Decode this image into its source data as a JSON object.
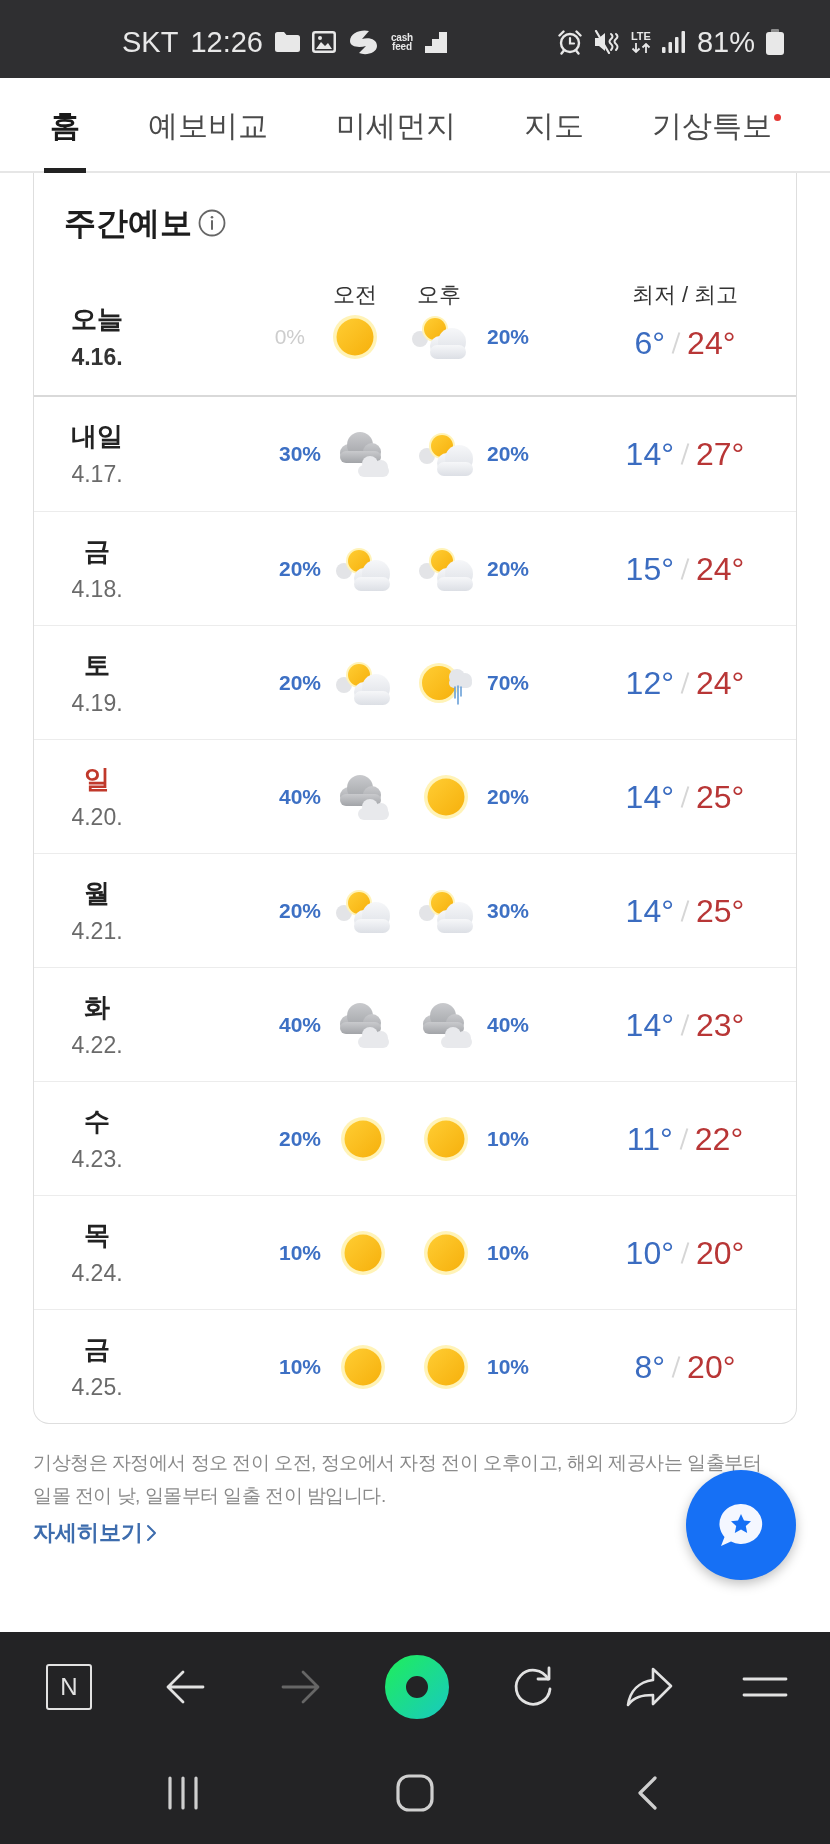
{
  "status_bar": {
    "carrier": "SKT",
    "time": "12:26",
    "app_label": "cash feed",
    "network": "LTE",
    "battery": "81%"
  },
  "tabs": [
    {
      "label": "홈",
      "selected": true,
      "new": false
    },
    {
      "label": "예보비교",
      "selected": false,
      "new": false
    },
    {
      "label": "미세먼지",
      "selected": false,
      "new": false
    },
    {
      "label": "지도",
      "selected": false,
      "new": false
    },
    {
      "label": "기상특보",
      "selected": false,
      "new": true
    }
  ],
  "forecast": {
    "title": "주간예보",
    "am_label": "오전",
    "pm_label": "오후",
    "temp_label": "최저 / 최고",
    "today": {
      "day": "오늘",
      "date": "4.16.",
      "am": {
        "kind": "sunny",
        "pop": "0%",
        "muted": true
      },
      "pm": {
        "kind": "partly_cloudy",
        "pop": "20%",
        "muted": false
      },
      "low": "6°",
      "high": "24°"
    },
    "days": [
      {
        "day": "내일",
        "date": "4.17.",
        "holiday": false,
        "am": {
          "kind": "cloudy",
          "pop": "30%",
          "muted": false
        },
        "pm": {
          "kind": "partly_cloudy",
          "pop": "20%",
          "muted": false
        },
        "low": "14°",
        "high": "27°"
      },
      {
        "day": "금",
        "date": "4.18.",
        "holiday": false,
        "am": {
          "kind": "partly_cloudy",
          "pop": "20%",
          "muted": false
        },
        "pm": {
          "kind": "partly_cloudy",
          "pop": "20%",
          "muted": false
        },
        "low": "15°",
        "high": "24°"
      },
      {
        "day": "토",
        "date": "4.19.",
        "holiday": false,
        "am": {
          "kind": "partly_cloudy",
          "pop": "20%",
          "muted": false
        },
        "pm": {
          "kind": "sun_rain",
          "pop": "70%",
          "muted": false
        },
        "low": "12°",
        "high": "24°"
      },
      {
        "day": "일",
        "date": "4.20.",
        "holiday": true,
        "am": {
          "kind": "cloudy",
          "pop": "40%",
          "muted": false
        },
        "pm": {
          "kind": "sunny",
          "pop": "20%",
          "muted": false
        },
        "low": "14°",
        "high": "25°"
      },
      {
        "day": "월",
        "date": "4.21.",
        "holiday": false,
        "am": {
          "kind": "partly_cloudy",
          "pop": "20%",
          "muted": false
        },
        "pm": {
          "kind": "partly_cloudy",
          "pop": "30%",
          "muted": false
        },
        "low": "14°",
        "high": "25°"
      },
      {
        "day": "화",
        "date": "4.22.",
        "holiday": false,
        "am": {
          "kind": "cloudy",
          "pop": "40%",
          "muted": false
        },
        "pm": {
          "kind": "cloudy",
          "pop": "40%",
          "muted": false
        },
        "low": "14°",
        "high": "23°"
      },
      {
        "day": "수",
        "date": "4.23.",
        "holiday": false,
        "am": {
          "kind": "sunny",
          "pop": "20%",
          "muted": false
        },
        "pm": {
          "kind": "sunny",
          "pop": "10%",
          "muted": false
        },
        "low": "11°",
        "high": "22°"
      },
      {
        "day": "목",
        "date": "4.24.",
        "holiday": false,
        "am": {
          "kind": "sunny",
          "pop": "10%",
          "muted": false
        },
        "pm": {
          "kind": "sunny",
          "pop": "10%",
          "muted": false
        },
        "low": "10°",
        "high": "20°"
      },
      {
        "day": "금",
        "date": "4.25.",
        "holiday": false,
        "am": {
          "kind": "sunny",
          "pop": "10%",
          "muted": false
        },
        "pm": {
          "kind": "sunny",
          "pop": "10%",
          "muted": false
        },
        "low": "8°",
        "high": "20°"
      }
    ]
  },
  "note": "기상청은 자정에서 정오 전이 오전, 정오에서 자정 전이 오후이고, 해외 제공사는 일출부터 일몰 전이 낮, 일몰부터 일출 전이 밤입니다.",
  "more_link": "자세히보기",
  "toolbar": [
    {
      "kind": "logo",
      "label": "N",
      "disabled": false
    },
    {
      "kind": "back",
      "disabled": false
    },
    {
      "kind": "forward",
      "disabled": true
    },
    {
      "kind": "ring",
      "disabled": false
    },
    {
      "kind": "reload",
      "disabled": false
    },
    {
      "kind": "share",
      "disabled": false
    },
    {
      "kind": "menu",
      "disabled": false
    }
  ]
}
